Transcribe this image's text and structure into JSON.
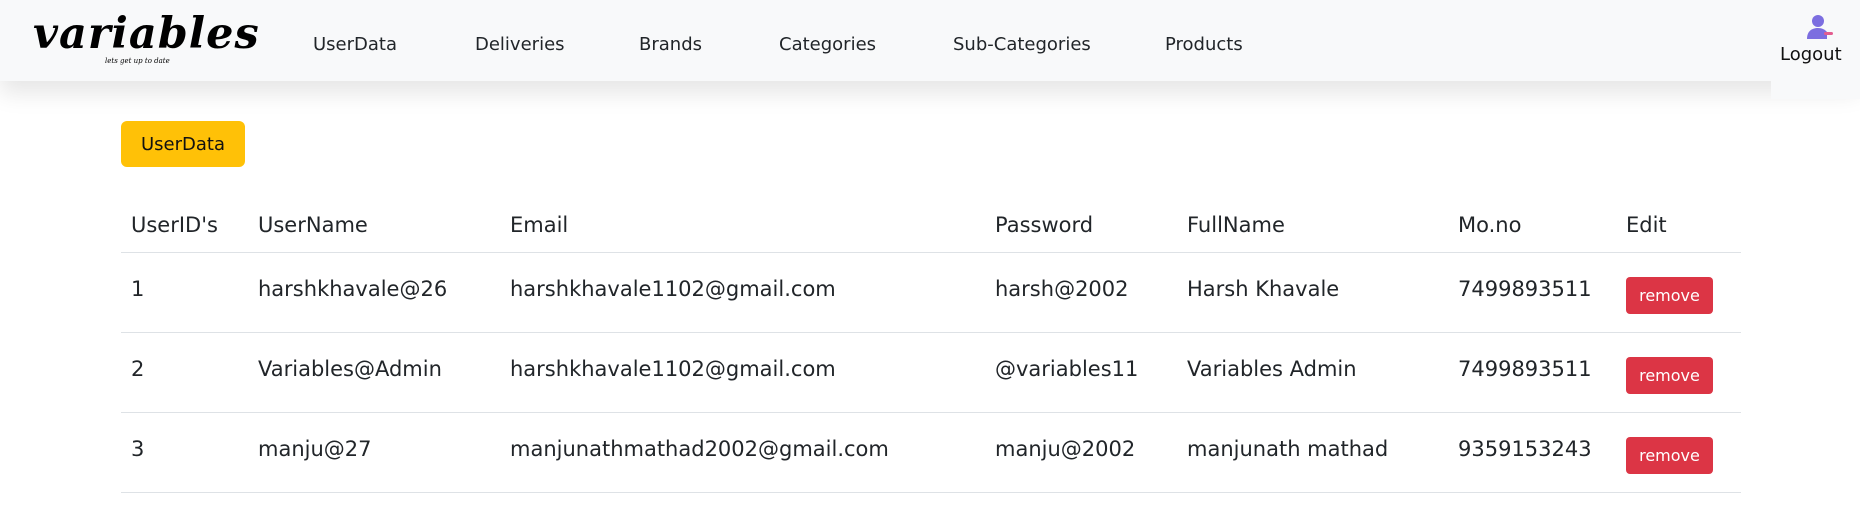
{
  "navbar": {
    "brand": {
      "name": "variables",
      "tagline": "lets get up to date"
    },
    "links": [
      "UserData",
      "Deliveries",
      "Brands",
      "Categories",
      "Sub-Categories",
      "Products"
    ],
    "logout_label": "Logout",
    "user_icon": "user-icon"
  },
  "section": {
    "button_label": "UserData"
  },
  "table": {
    "headers": [
      "UserID's",
      "UserName",
      "Email",
      "Password",
      "FullName",
      "Mo.no",
      "Edit"
    ],
    "rows": [
      {
        "id": "1",
        "username": "harshkhavale@26",
        "email": "harshkhavale1102@gmail.com",
        "password": "harsh@2002",
        "fullname": "Harsh Khavale",
        "mobile": "7499893511",
        "action": "remove"
      },
      {
        "id": "2",
        "username": "Variables@Admin",
        "email": "harshkhavale1102@gmail.com",
        "password": "@variables11",
        "fullname": "Variables Admin",
        "mobile": "7499893511",
        "action": "remove"
      },
      {
        "id": "3",
        "username": "manju@27",
        "email": "manjunathmathad2002@gmail.com",
        "password": "manju@2002",
        "fullname": "manjunath mathad",
        "mobile": "9359153243",
        "action": "remove"
      }
    ]
  },
  "colors": {
    "navbar_bg": "#f8f9fa",
    "accent_yellow": "#ffc107",
    "danger_red": "#dc3545",
    "user_icon_purple": "#7c6ee0"
  }
}
